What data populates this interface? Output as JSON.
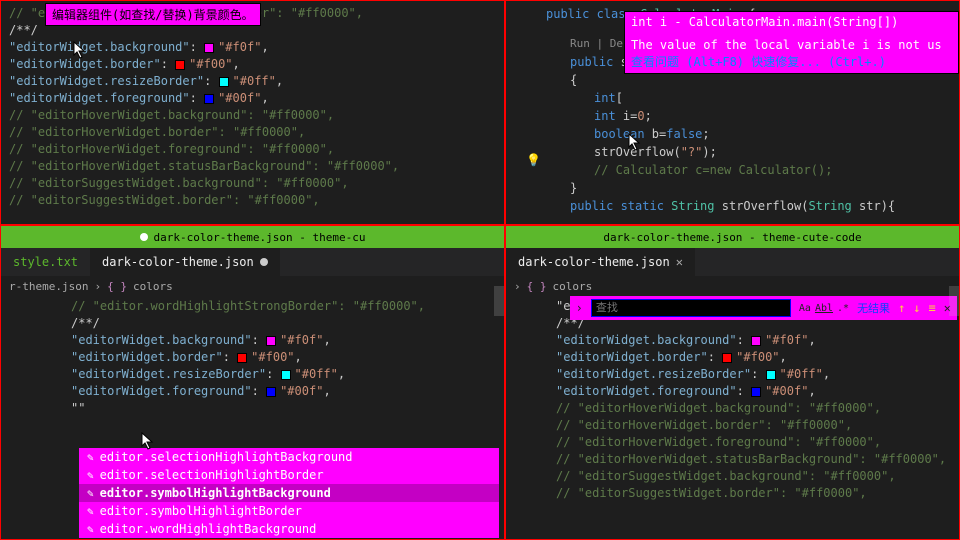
{
  "colors": {
    "magenta": "#ff00ff",
    "green_title": "#5cb82c",
    "red_border": "#ff0000"
  },
  "tl": {
    "tooltip": "编辑器组件(如查找/替换)背景颜色。",
    "lines": [
      {
        "raw": "// \"editor.wordHighlightStrongBorder\": \"#ff0000\",",
        "comment": true
      },
      {
        "raw": "/**/"
      },
      {
        "key": "editorWidget.background",
        "val": "#f0f",
        "swatch": "#ff00ff"
      },
      {
        "key": "editorWidget.border",
        "val": "#f00",
        "swatch": "#ff0000"
      },
      {
        "key": "editorWidget.resizeBorder",
        "val": "#0ff",
        "swatch": "#00ffff"
      },
      {
        "key": "editorWidget.foreground",
        "val": "#00f",
        "swatch": "#0000ff"
      },
      {
        "raw": "// \"editorHoverWidget.background\": \"#ff0000\",",
        "comment": true
      },
      {
        "raw": "// \"editorHoverWidget.border\": \"#ff0000\",",
        "comment": true
      },
      {
        "raw": "// \"editorHoverWidget.foreground\": \"#ff0000\",",
        "comment": true
      },
      {
        "raw": "// \"editorHoverWidget.statusBarBackground\": \"#ff0000\",",
        "comment": true
      },
      {
        "raw": "// \"editorSuggestWidget.background\": \"#ff0000\",",
        "comment": true
      },
      {
        "raw": "// \"editorSuggestWidget.border\": \"#ff0000\",",
        "comment": true
      }
    ]
  },
  "tr": {
    "class_sig": "public class CalculatorMain {",
    "run_links": "Run | Debu",
    "method": "public s",
    "body": [
      "int[",
      "int i=0;",
      "boolean b=false;",
      "strOverflow(\"?\");",
      "// Calculator c=new Calculator();"
    ],
    "end_brace": "}",
    "next_sig": "public static String strOverflow(String str){",
    "hover_title": "int i - CalculatorMain.main(String[])",
    "hover_body": "The value of the local variable i is not us",
    "hover_hint": "查看问题 (Alt+F8)   快速修复... (Ctrl+.)"
  },
  "bl": {
    "title": "dark-color-theme.json - theme-cu",
    "tabs": [
      {
        "label": "style.txt",
        "green": true,
        "active": false
      },
      {
        "label": "dark-color-theme.json",
        "modified": true,
        "active": true
      }
    ],
    "breadcrumb_root": "r-theme.json",
    "breadcrumb_item": "colors",
    "lines": [
      {
        "raw": "// \"editor.wordHighlightStrongBorder\": \"#ff0000\",",
        "comment": true
      },
      {
        "raw": "/**/"
      },
      {
        "key": "editorWidget.background",
        "val": "#f0f",
        "swatch": "#ff00ff"
      },
      {
        "key": "editorWidget.border",
        "val": "#f00",
        "swatch": "#ff0000"
      },
      {
        "key": "editorWidget.resizeBorder",
        "val": "#0ff",
        "swatch": "#00ffff"
      },
      {
        "key": "editorWidget.foreground",
        "val": "#00f",
        "swatch": "#0000ff"
      },
      {
        "raw": "\"\""
      }
    ],
    "suggest": [
      {
        "icon": "✎",
        "label": "editor.selectionHighlightBackground"
      },
      {
        "icon": "✎",
        "label": "editor.selectionHighlightBorder"
      },
      {
        "icon": "✎",
        "label": "editor.symbolHighlightBackground",
        "sel": true
      },
      {
        "icon": "✎",
        "label": "editor.symbolHighlightBorder"
      },
      {
        "icon": "✎",
        "label": "editor.wordHighlightBackground"
      }
    ]
  },
  "br": {
    "title": "dark-color-theme.json - theme-cute-code",
    "tabs": [
      {
        "label": "dark-color-theme.json",
        "active": true,
        "closable": true
      }
    ],
    "breadcrumb_item": "colors",
    "find": {
      "placeholder": "查找",
      "case": "Aa",
      "word": "Abl",
      "regex": ".*",
      "no_result": "无结果",
      "prev": "↑",
      "next": "↓",
      "menu": "≡",
      "close": "✕"
    },
    "lines": [
      {
        "raw": "\"edit",
        "partial": true
      },
      {
        "raw": "/**/"
      },
      {
        "key": "editorWidget.background",
        "val": "#f0f",
        "swatch": "#ff00ff"
      },
      {
        "key": "editorWidget.border",
        "val": "#f00",
        "swatch": "#ff0000"
      },
      {
        "key": "editorWidget.resizeBorder",
        "val": "#0ff",
        "swatch": "#00ffff"
      },
      {
        "key": "editorWidget.foreground",
        "val": "#00f",
        "swatch": "#0000ff"
      },
      {
        "raw": "// \"editorHoverWidget.background\": \"#ff0000\",",
        "comment": true
      },
      {
        "raw": "// \"editorHoverWidget.border\": \"#ff0000\",",
        "comment": true
      },
      {
        "raw": "// \"editorHoverWidget.foreground\": \"#ff0000\",",
        "comment": true
      },
      {
        "raw": "// \"editorHoverWidget.statusBarBackground\": \"#ff0000\",",
        "comment": true
      },
      {
        "raw": "// \"editorSuggestWidget.background\": \"#ff0000\",",
        "comment": true
      },
      {
        "raw": "// \"editorSuggestWidget.border\": \"#ff0000\",",
        "comment": true
      }
    ]
  }
}
